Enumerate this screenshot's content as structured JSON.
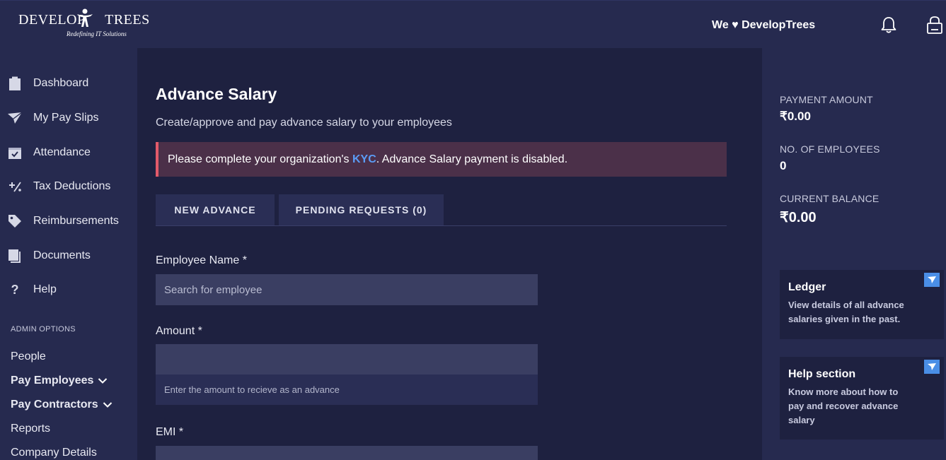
{
  "header": {
    "logo_text": "DEVELOP TREES",
    "logo_tagline": "Redefining IT Solutions",
    "love_text": "We ♥ DevelopTrees",
    "icons": [
      "bell-icon",
      "lock-icon"
    ]
  },
  "sidebar": {
    "items": [
      {
        "label": "Dashboard",
        "icon": "clipboard-icon"
      },
      {
        "label": "My Pay Slips",
        "icon": "paper-plane-icon"
      },
      {
        "label": "Attendance",
        "icon": "calendar-check-icon"
      },
      {
        "label": "Tax Deductions",
        "icon": "percent-icon"
      },
      {
        "label": "Reimbursements",
        "icon": "tag-icon"
      },
      {
        "label": "Documents",
        "icon": "documents-icon"
      },
      {
        "label": "Help",
        "icon": "question-icon"
      }
    ],
    "admin_title": "ADMIN OPTIONS",
    "admin_items": [
      {
        "label": "People"
      },
      {
        "label": "Pay Employees"
      },
      {
        "label": "Pay Contractors"
      },
      {
        "label": "Reports"
      },
      {
        "label": "Company Details"
      }
    ]
  },
  "main": {
    "title": "Advance Salary",
    "subtitle": "Create/approve and pay advance salary to your employees",
    "alert": {
      "before": "Please complete your organization's ",
      "link": "KYC",
      "after": ". Advance Salary payment is disabled."
    },
    "tabs": [
      {
        "label": "NEW ADVANCE"
      },
      {
        "label": "PENDING REQUESTS (0)"
      }
    ],
    "form": {
      "employee_label": "Employee Name *",
      "employee_placeholder": "Search for employee",
      "amount_label": "Amount *",
      "amount_value": "",
      "amount_help": "Enter the amount to recieve as an advance",
      "emi_label": "EMI *",
      "emi_value": ""
    }
  },
  "right_panel": {
    "stats": [
      {
        "label": "PAYMENT AMOUNT",
        "value": "₹0.00"
      },
      {
        "label": "NO. OF EMPLOYEES",
        "value": "0"
      },
      {
        "label": "CURRENT BALANCE",
        "value": "₹0.00"
      }
    ],
    "cards": [
      {
        "title": "Ledger",
        "text": "View details of all advance salaries given in the past."
      },
      {
        "title": "Help section",
        "text": "Know more about how to pay and recover advance salary"
      }
    ]
  },
  "colors": {
    "background": "#1e2140",
    "panel": "#262a4f",
    "alert_bg": "#4b3049",
    "alert_border": "#e35a6a",
    "link": "#5b9cf5",
    "corner_badge": "#4a8ee6"
  }
}
